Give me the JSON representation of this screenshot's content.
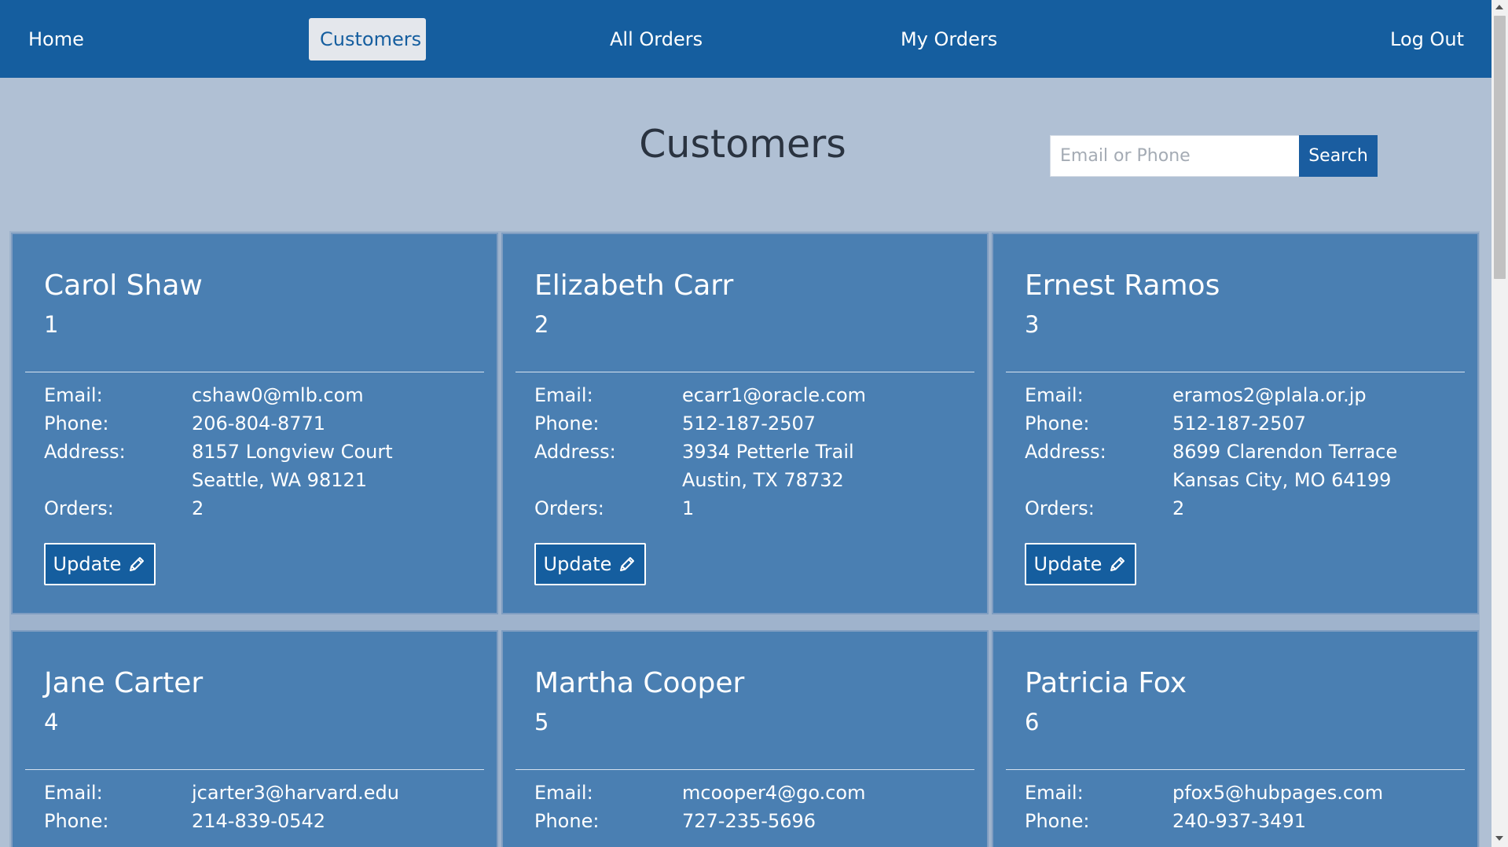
{
  "nav": {
    "home": "Home",
    "customers": "Customers",
    "all_orders": "All Orders",
    "my_orders": "My Orders",
    "logout": "Log Out",
    "active": "Customers"
  },
  "page": {
    "title": "Customers"
  },
  "search": {
    "placeholder": "Email or Phone",
    "button_label": "Search"
  },
  "labels": {
    "email": "Email:",
    "phone": "Phone:",
    "address": "Address:",
    "orders": "Orders:",
    "update": "Update"
  },
  "customers": [
    {
      "name": "Carol Shaw",
      "id": "1",
      "email": "cshaw0@mlb.com",
      "phone": "206-804-8771",
      "address_line1": "8157 Longview Court",
      "address_line2": "Seattle, WA 98121",
      "orders": "2"
    },
    {
      "name": "Elizabeth Carr",
      "id": "2",
      "email": "ecarr1@oracle.com",
      "phone": "512-187-2507",
      "address_line1": "3934 Petterle Trail",
      "address_line2": "Austin, TX 78732",
      "orders": "1"
    },
    {
      "name": "Ernest Ramos",
      "id": "3",
      "email": "eramos2@plala.or.jp",
      "phone": "512-187-2507",
      "address_line1": "8699 Clarendon Terrace",
      "address_line2": "Kansas City, MO 64199",
      "orders": "2"
    },
    {
      "name": "Jane Carter",
      "id": "4",
      "email": "jcarter3@harvard.edu",
      "phone": "214-839-0542"
    },
    {
      "name": "Martha Cooper",
      "id": "5",
      "email": "mcooper4@go.com",
      "phone": "727-235-5696"
    },
    {
      "name": "Patricia Fox",
      "id": "6",
      "email": "pfox5@hubpages.com",
      "phone": "240-937-3491"
    }
  ],
  "colors": {
    "navbar": "#155e9f",
    "page_background": "#b0c0d4",
    "card_background": "#4a7fb2",
    "active_tab": "#e4e7ec"
  },
  "icons": {
    "update": "pencil-icon"
  }
}
